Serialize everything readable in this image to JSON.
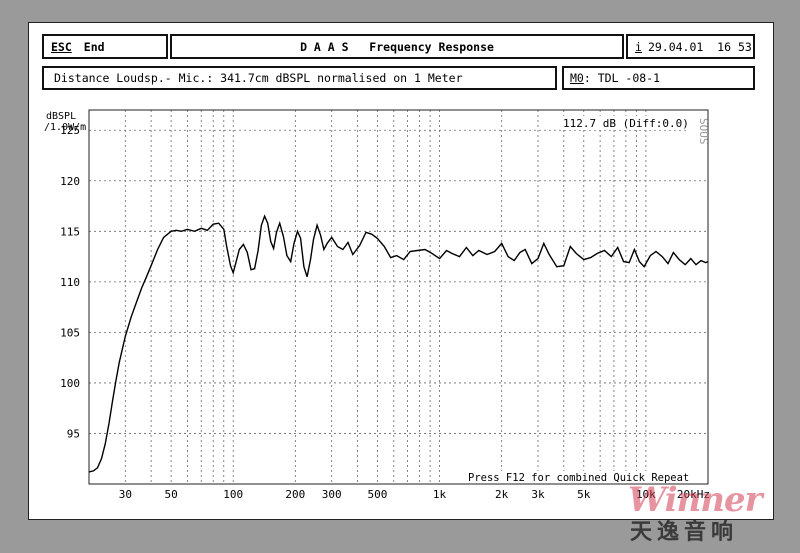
{
  "header": {
    "esc_key": "ESC",
    "end_label": "End",
    "title": "D A A S   Frequency Response",
    "info_key": "i",
    "datetime": "29.04.01  16 53"
  },
  "subheader": {
    "measurement": "Distance Loudsp.- Mic.: 341.7cm dBSPL normalised on 1 Meter",
    "memory_key": "M0",
    "memory_value": ": TDL -08-1"
  },
  "chart_data": {
    "type": "line",
    "ylabel": "dBSPL /1.0W/m",
    "xscale": "log",
    "xlim": [
      20,
      20000
    ],
    "ylim": [
      90,
      127
    ],
    "grid": true,
    "x_tick_labels": [
      "30",
      "50",
      "100",
      "200",
      "300",
      "500",
      "1k",
      "2k",
      "3k",
      "5k",
      "10k",
      "20kHz"
    ],
    "x_ticks": [
      30,
      50,
      100,
      200,
      300,
      500,
      1000,
      2000,
      3000,
      5000,
      10000,
      20000
    ],
    "y_tick_labels": [
      "125",
      "120",
      "115",
      "110",
      "105",
      "100",
      "95"
    ],
    "y_ticks": [
      125,
      120,
      115,
      110,
      105,
      100,
      95
    ],
    "readout": "112.7 dB (Diff:0.0)",
    "vertical_tag": "SOUS",
    "footer_note": "Press F12 for combined Quick Repeat",
    "series": [
      {
        "x": [
          20,
          21,
          22,
          23,
          24,
          25,
          26,
          27,
          28,
          30,
          32,
          34,
          36,
          38,
          40,
          43,
          46,
          50,
          53,
          56,
          60,
          65,
          70,
          75,
          80,
          85,
          90,
          93,
          97,
          100,
          103,
          107,
          112,
          117,
          122,
          127,
          132,
          137,
          142,
          147,
          152,
          157,
          162,
          168,
          175,
          182,
          190,
          197,
          205,
          212,
          220,
          228,
          237,
          245,
          255,
          265,
          275,
          285,
          300,
          320,
          340,
          360,
          380,
          410,
          440,
          470,
          500,
          540,
          580,
          620,
          670,
          720,
          780,
          850,
          920,
          1000,
          1080,
          1150,
          1250,
          1350,
          1450,
          1550,
          1700,
          1850,
          2000,
          2150,
          2300,
          2450,
          2600,
          2800,
          3000,
          3200,
          3400,
          3700,
          4000,
          4300,
          4600,
          5000,
          5400,
          5800,
          6300,
          6800,
          7300,
          7800,
          8300,
          8800,
          9300,
          9800,
          10500,
          11200,
          12000,
          12800,
          13600,
          14500,
          15500,
          16500,
          17500,
          18500,
          19500,
          20000
        ],
        "y": [
          91.2,
          91.3,
          91.6,
          92.5,
          94.0,
          96.0,
          98.2,
          100.2,
          102.0,
          104.6,
          106.5,
          108.0,
          109.4,
          110.5,
          111.6,
          113.2,
          114.4,
          115.0,
          115.1,
          115.0,
          115.2,
          115.0,
          115.3,
          115.1,
          115.7,
          115.8,
          115.2,
          113.5,
          111.6,
          110.9,
          111.9,
          113.2,
          113.7,
          112.9,
          111.2,
          111.3,
          113.1,
          115.6,
          116.5,
          115.8,
          114.0,
          113.3,
          114.9,
          115.8,
          114.5,
          112.6,
          112.0,
          113.8,
          115.0,
          114.3,
          111.5,
          110.5,
          112.2,
          114.2,
          115.6,
          114.6,
          113.2,
          113.8,
          114.4,
          113.5,
          113.2,
          113.9,
          112.7,
          113.6,
          114.9,
          114.7,
          114.3,
          113.5,
          112.4,
          112.6,
          112.2,
          113.0,
          113.1,
          113.2,
          112.8,
          112.3,
          113.1,
          112.8,
          112.5,
          113.4,
          112.6,
          113.1,
          112.7,
          113.0,
          113.8,
          112.5,
          112.1,
          112.9,
          113.2,
          111.8,
          112.3,
          113.8,
          112.7,
          111.5,
          111.6,
          113.5,
          112.8,
          112.2,
          112.4,
          112.8,
          113.1,
          112.5,
          113.4,
          112.0,
          111.9,
          113.2,
          112.0,
          111.5,
          112.6,
          113.0,
          112.5,
          111.8,
          112.9,
          112.2,
          111.7,
          112.3,
          111.7,
          112.1,
          111.9,
          112.0
        ]
      }
    ]
  },
  "watermark": {
    "brand": "Winner",
    "chinese": "天逸音响"
  },
  "colors": {
    "background": "#9a9a9a",
    "panel": "#ffffff",
    "grid": "#6a6a6a",
    "curve": "#000000",
    "watermark": "#d23c50"
  }
}
